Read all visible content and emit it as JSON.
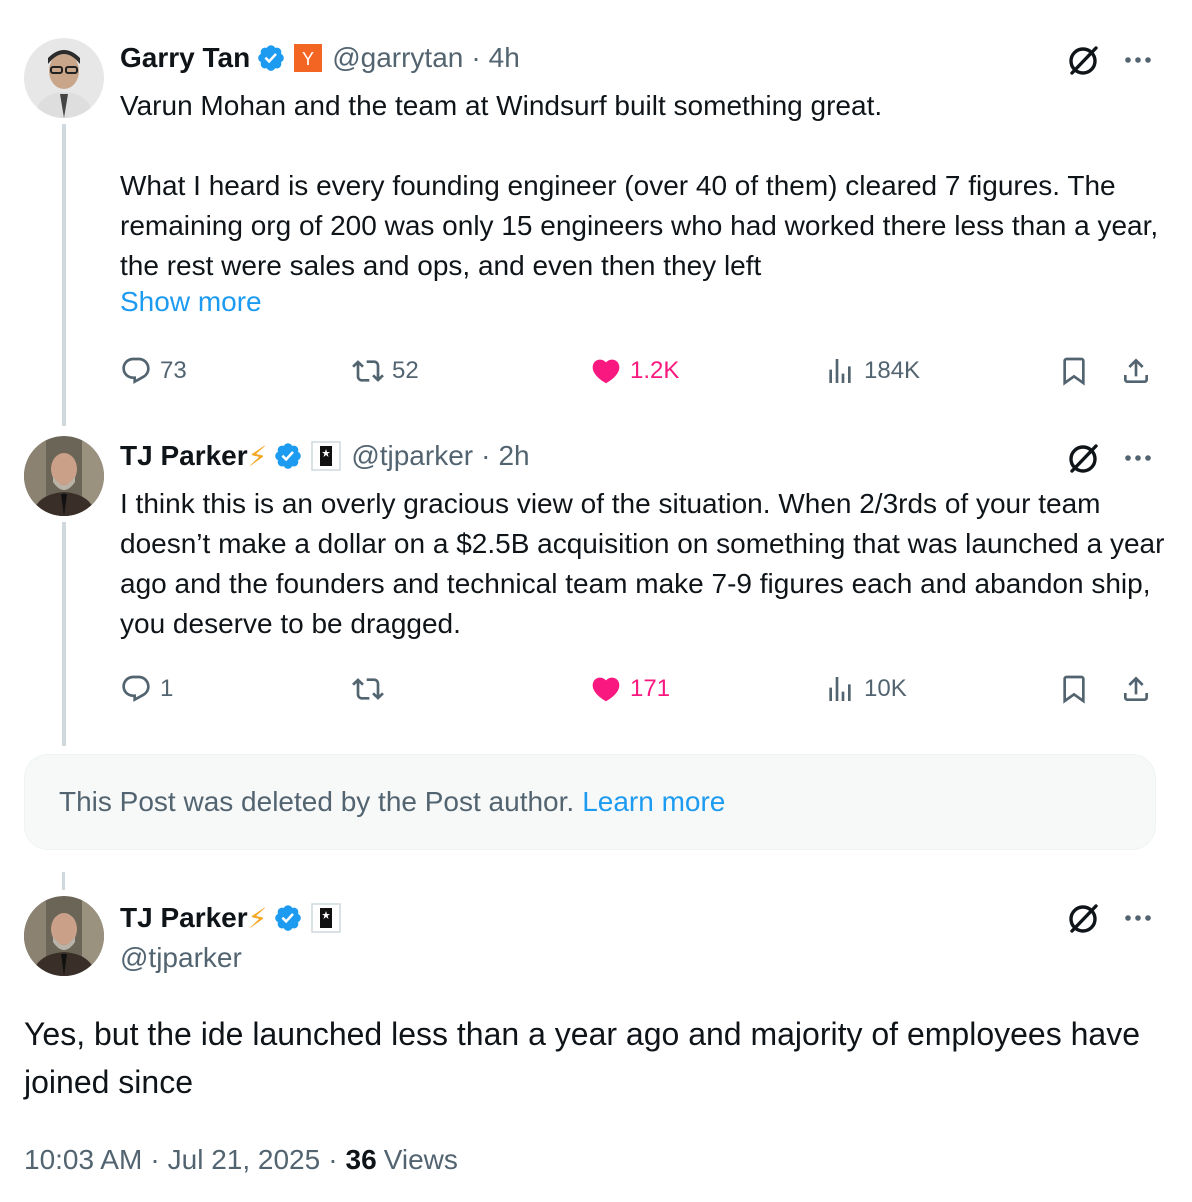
{
  "tweets": [
    {
      "name": "Garry Tan",
      "affiliate_badge": "Y",
      "handle": "@garrytan",
      "separator": "·",
      "time": "4h",
      "text": "Varun Mohan and the team at Windsurf built something great.\n\nWhat I heard is every founding engineer (over 40 of them) cleared 7 figures. The remaining org of 200 was only 15 engineers who had worked there less than a year, the rest were sales and ops, and even then they left",
      "show_more": "Show more",
      "replies": "73",
      "reposts": "52",
      "likes": "1.2K",
      "views": "184K"
    },
    {
      "name": "TJ Parker",
      "emoji": "⚡",
      "handle": "@tjparker",
      "separator": "·",
      "time": "2h",
      "text": "I think this is an overly gracious view of the situation. When 2/3rds of your team doesn’t make a dollar on a $2.5B acquisition on something that was launched a year ago and the founders and technical team make 7-9 figures each and abandon ship, you deserve to be dragged.",
      "replies": "1",
      "reposts": "",
      "likes": "171",
      "views": "10K"
    }
  ],
  "deleted_notice": {
    "text": "This Post was deleted by the Post author.",
    "link": "Learn more"
  },
  "main_post": {
    "name": "TJ Parker",
    "emoji": "⚡",
    "handle": "@tjparker",
    "text": "Yes, but the ide launched less than a year ago and majority of employees have joined since",
    "time": "10:03 AM",
    "date": "Jul 21, 2025",
    "separator": "·",
    "views_count": "36",
    "views_label": "Views"
  },
  "colors": {
    "text": "#0f1419",
    "secondary": "#536471",
    "link": "#1d9bf0",
    "like": "#f91880",
    "verified": "#1d9bf0",
    "yc": "#f26522"
  }
}
